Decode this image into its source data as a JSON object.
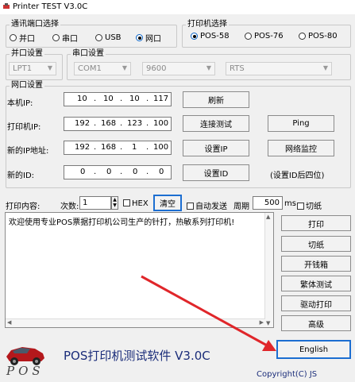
{
  "window": {
    "title": "Printer TEST V3.0C"
  },
  "comm_port": {
    "legend": "通讯端口选择",
    "options": [
      {
        "label": "并口",
        "selected": false
      },
      {
        "label": "串口",
        "selected": false
      },
      {
        "label": "USB",
        "selected": false
      },
      {
        "label": "网口",
        "selected": true
      }
    ]
  },
  "printer_select": {
    "legend": "打印机选择",
    "options": [
      {
        "label": "POS-58",
        "selected": true
      },
      {
        "label": "POS-76",
        "selected": false
      },
      {
        "label": "POS-80",
        "selected": false
      }
    ]
  },
  "parallel": {
    "legend": "并口设置",
    "port": "LPT1"
  },
  "serial": {
    "legend": "串口设置",
    "port": "COM1",
    "baud": "9600",
    "flow": "RTS"
  },
  "network": {
    "legend": "网口设置",
    "local_ip": {
      "label": "本机IP:",
      "octets": [
        "10",
        "10",
        "10",
        "117"
      ]
    },
    "printer_ip": {
      "label": "打印机IP:",
      "octets": [
        "192",
        "168",
        "123",
        "100"
      ]
    },
    "new_ip": {
      "label": "新的IP地址:",
      "octets": [
        "192",
        "168",
        "1",
        "100"
      ]
    },
    "new_id": {
      "label": "新的ID:",
      "octets": [
        "0",
        "0",
        "0",
        "0"
      ]
    },
    "refresh_label": "刷新",
    "connect_test_label": "连接测试",
    "ping_label": "Ping",
    "set_ip_label": "设置IP",
    "net_monitor_label": "网络监控",
    "set_id_label": "设置ID",
    "id_hint": "(设置ID后四位)"
  },
  "print_content": {
    "label": "打印内容:",
    "count_label": "次数:",
    "count_value": "1",
    "hex_label": "HEX",
    "clear_label": "清空",
    "auto_send_label": "自动发送",
    "period_label": "周期",
    "period_value": "500",
    "period_unit": "ms",
    "cut_label": "切纸",
    "text": "欢迎使用专业POS票据打印机公司生产的针打，热敏系列打印机!"
  },
  "actions": {
    "print": "打印",
    "cut": "切纸",
    "drawer": "开钱箱",
    "traditional_test": "繁体测试",
    "driver_print": "驱动打印",
    "advanced": "高级",
    "english": "English"
  },
  "footer": {
    "logo_text": "POS",
    "app_name": "POS打印机测试软件 V3.0C",
    "copyright": "Copyright(C) JS"
  },
  "colors": {
    "accent": "#1c6ed1",
    "arrow": "#e0262a",
    "app_name": "#1b2d7a"
  }
}
